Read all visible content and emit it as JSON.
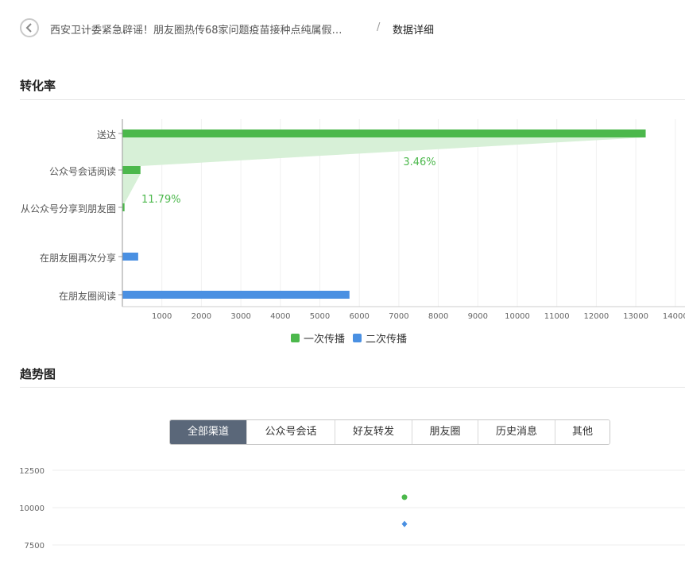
{
  "header": {
    "article_title": "西安卫计委紧急辟谣！朋友圈热传68家问题疫苗接种点纯属假…",
    "separator": "/",
    "current_page": "数据详细"
  },
  "sections": {
    "conversion_title": "转化率",
    "trend_title": "趋势图"
  },
  "colors": {
    "primary_spread": "#4cb84c",
    "secondary_spread": "#4a90e2",
    "funnel_fill": "#d7f0d7",
    "rate_text": "#4cb84c",
    "active_tab": "#5a6779"
  },
  "chart_data": [
    {
      "type": "bar",
      "orientation": "horizontal",
      "categories": [
        "送达",
        "公众号会话阅读",
        "从公众号分享到朋友圈",
        "在朋友圈再次分享",
        "在朋友圈阅读"
      ],
      "series": [
        {
          "name": "一次传播",
          "values": [
            13250,
            458,
            54,
            null,
            null
          ]
        },
        {
          "name": "二次传播",
          "values": [
            null,
            null,
            null,
            400,
            5750
          ]
        }
      ],
      "conversion_labels": [
        "3.46%",
        "11.79%"
      ],
      "x_ticks": [
        1000,
        2000,
        3000,
        4000,
        5000,
        6000,
        7000,
        8000,
        9000,
        10000,
        11000,
        12000,
        13000,
        14000
      ],
      "xlim": [
        0,
        14000
      ],
      "grid": true,
      "legend_position": "bottom"
    },
    {
      "type": "scatter",
      "y_ticks": [
        12500,
        10000,
        7500
      ],
      "series": [
        {
          "name": "一次传播",
          "values": [
            10700
          ],
          "marker": "circle"
        },
        {
          "name": "二次传播",
          "values": [
            8900
          ],
          "marker": "diamond"
        }
      ],
      "grid": true
    }
  ],
  "tabs": {
    "items": [
      "全部渠道",
      "公众号会话",
      "好友转发",
      "朋友圈",
      "历史消息",
      "其他"
    ],
    "active": 0
  }
}
